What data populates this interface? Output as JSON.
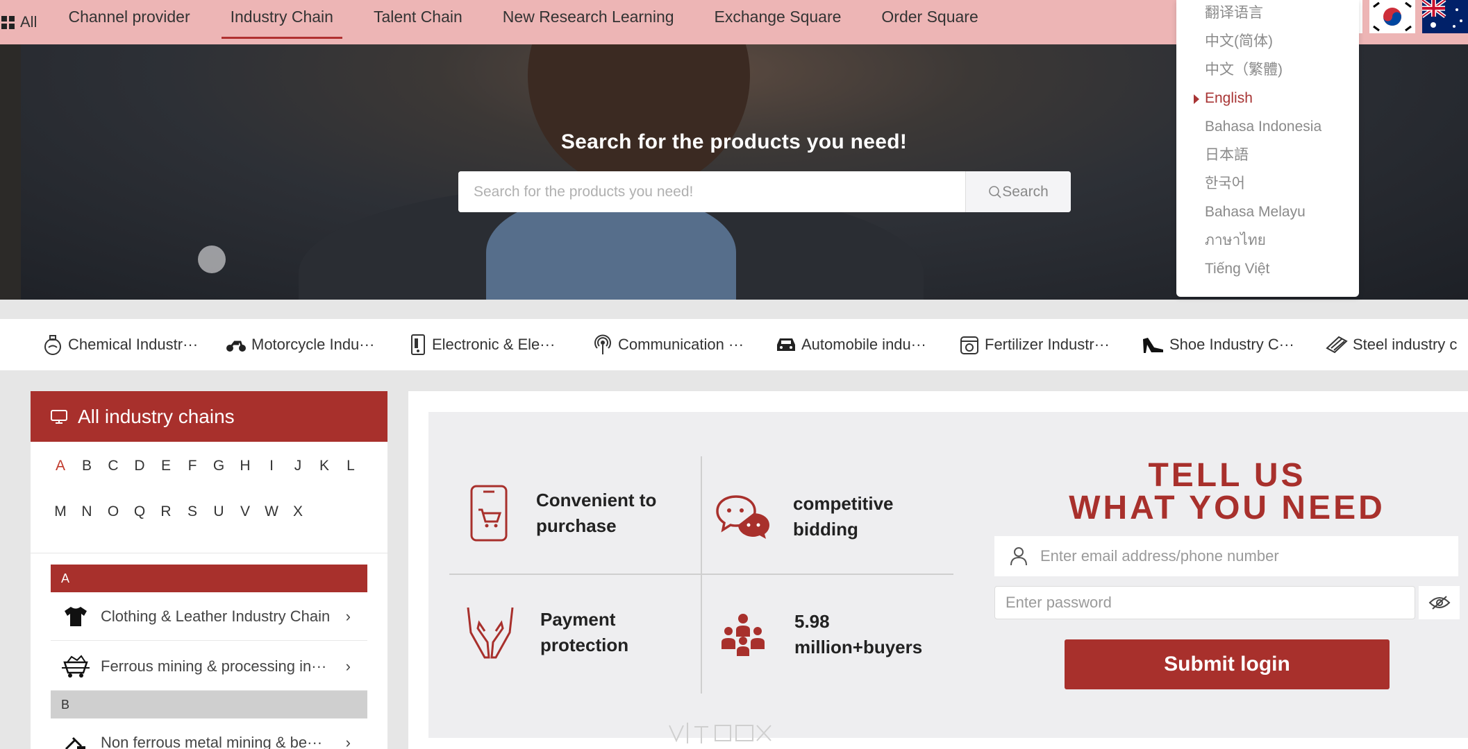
{
  "nav": {
    "all_label": "All",
    "items": [
      "Channel provider",
      "Industry Chain",
      "Talent Chain",
      "New Research Learning",
      "Exchange Square",
      "Order Square"
    ],
    "active_index": 1
  },
  "language_menu": {
    "items": [
      "翻译语言",
      "中文(简体)",
      "中文（繁體)",
      "English",
      "Bahasa Indonesia",
      "日本語",
      "한국어",
      "Bahasa Melayu",
      "ภาษาไทย",
      "Tiếng Việt"
    ],
    "selected": "English"
  },
  "hero": {
    "title": "Search for the products you need!",
    "search_placeholder": "Search for the products you need!",
    "search_button": "Search"
  },
  "categories": [
    {
      "label": "Chemical Industr···",
      "icon": "flask-icon"
    },
    {
      "label": "Motorcycle Indu···",
      "icon": "motorcycle-icon"
    },
    {
      "label": "Electronic & Ele···",
      "icon": "device-icon"
    },
    {
      "label": "Communication ···",
      "icon": "antenna-icon"
    },
    {
      "label": "Automobile indu···",
      "icon": "car-icon"
    },
    {
      "label": "Fertilizer Industr···",
      "icon": "fertilizer-icon"
    },
    {
      "label": "Shoe Industry C···",
      "icon": "high-heel-icon"
    },
    {
      "label": "Steel industry c",
      "icon": "steel-icon"
    }
  ],
  "sidebar": {
    "title": "All industry chains",
    "letters": [
      "A",
      "B",
      "C",
      "D",
      "E",
      "F",
      "G",
      "H",
      "I",
      "J",
      "K",
      "L",
      "M",
      "N",
      "O",
      "Q",
      "R",
      "S",
      "U",
      "V",
      "W",
      "X"
    ],
    "active_letter": "A",
    "groups": [
      {
        "letter": "A",
        "items": [
          "Clothing & Leather Industry Chain",
          "Ferrous mining & processing in···"
        ]
      },
      {
        "letter": "B",
        "items": [
          "Non ferrous metal mining & be···"
        ]
      }
    ]
  },
  "features": [
    {
      "text": "Convenient to purchase",
      "icon": "phone-cart-icon"
    },
    {
      "text": "competitive bidding",
      "icon": "chat-bubbles-icon"
    },
    {
      "text": "Payment protection",
      "icon": "hands-icon"
    },
    {
      "text": "5.98 million+buyers",
      "icon": "people-icon"
    }
  ],
  "login": {
    "heading_line1": "TELL US",
    "heading_line2": "WHAT YOU NEED",
    "email_placeholder": "Enter email address/phone number",
    "password_placeholder": "Enter password",
    "submit_label": "Submit login"
  },
  "colors": {
    "brand": "#a8302c",
    "nav_bg": "#edb5b5",
    "page_bg": "#e6e6e6"
  }
}
